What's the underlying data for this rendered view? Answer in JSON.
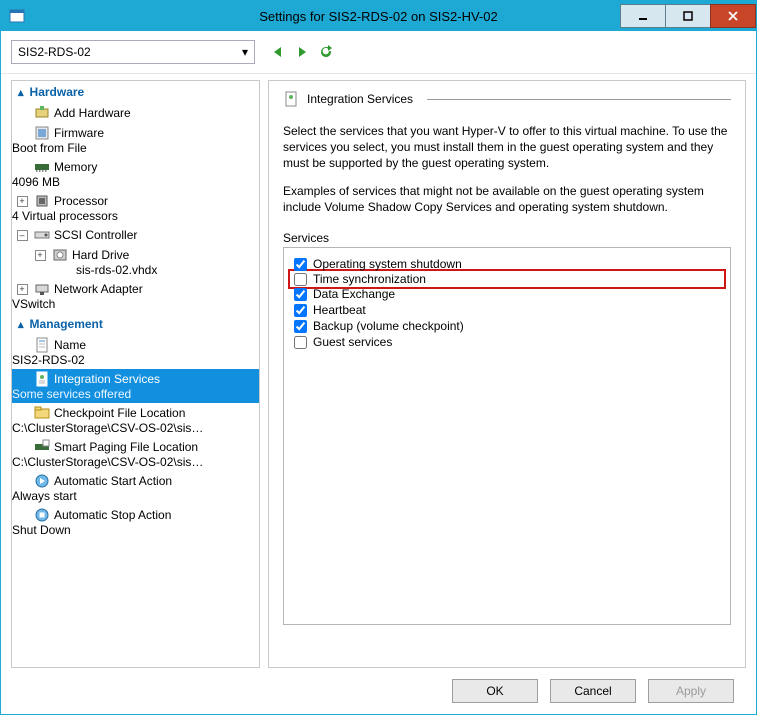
{
  "window": {
    "title": "Settings for SIS2-RDS-02 on SIS2-HV-02"
  },
  "toolbar": {
    "vm_selected": "SIS2-RDS-02"
  },
  "tree": {
    "hardware_hdr": "Hardware",
    "management_hdr": "Management",
    "items": {
      "add_hardware": "Add Hardware",
      "firmware": "Firmware",
      "firmware_sub": "Boot from File",
      "memory": "Memory",
      "memory_sub": "4096 MB",
      "processor": "Processor",
      "processor_sub": "4 Virtual processors",
      "scsi": "SCSI Controller",
      "hard_drive": "Hard Drive",
      "hard_drive_sub": "sis-rds-02.vhdx",
      "net": "Network Adapter",
      "net_sub": "VSwitch",
      "name": "Name",
      "name_sub": "SIS2-RDS-02",
      "integ": "Integration Services",
      "integ_sub": "Some services offered",
      "chk": "Checkpoint File Location",
      "chk_sub": "C:\\ClusterStorage\\CSV-OS-02\\sis2...",
      "smart": "Smart Paging File Location",
      "smart_sub": "C:\\ClusterStorage\\CSV-OS-02\\sis2...",
      "astart": "Automatic Start Action",
      "astart_sub": "Always start",
      "astop": "Automatic Stop Action",
      "astop_sub": "Shut Down"
    }
  },
  "right": {
    "title": "Integration Services",
    "p1": "Select the services that you want Hyper-V to offer to this virtual machine. To use the services you select, you must install them in the guest operating system and they must be supported by the guest operating system.",
    "p2": "Examples of services that might not be available on the guest operating system include Volume Shadow Copy Services and operating system shutdown.",
    "group": "Services",
    "services": [
      {
        "label": "Operating system shutdown",
        "checked": true,
        "hl": false
      },
      {
        "label": "Time synchronization",
        "checked": false,
        "hl": true
      },
      {
        "label": "Data Exchange",
        "checked": true,
        "hl": false
      },
      {
        "label": "Heartbeat",
        "checked": true,
        "hl": false
      },
      {
        "label": "Backup (volume checkpoint)",
        "checked": true,
        "hl": false
      },
      {
        "label": "Guest services",
        "checked": false,
        "hl": false
      }
    ]
  },
  "buttons": {
    "ok": "OK",
    "cancel": "Cancel",
    "apply": "Apply"
  }
}
